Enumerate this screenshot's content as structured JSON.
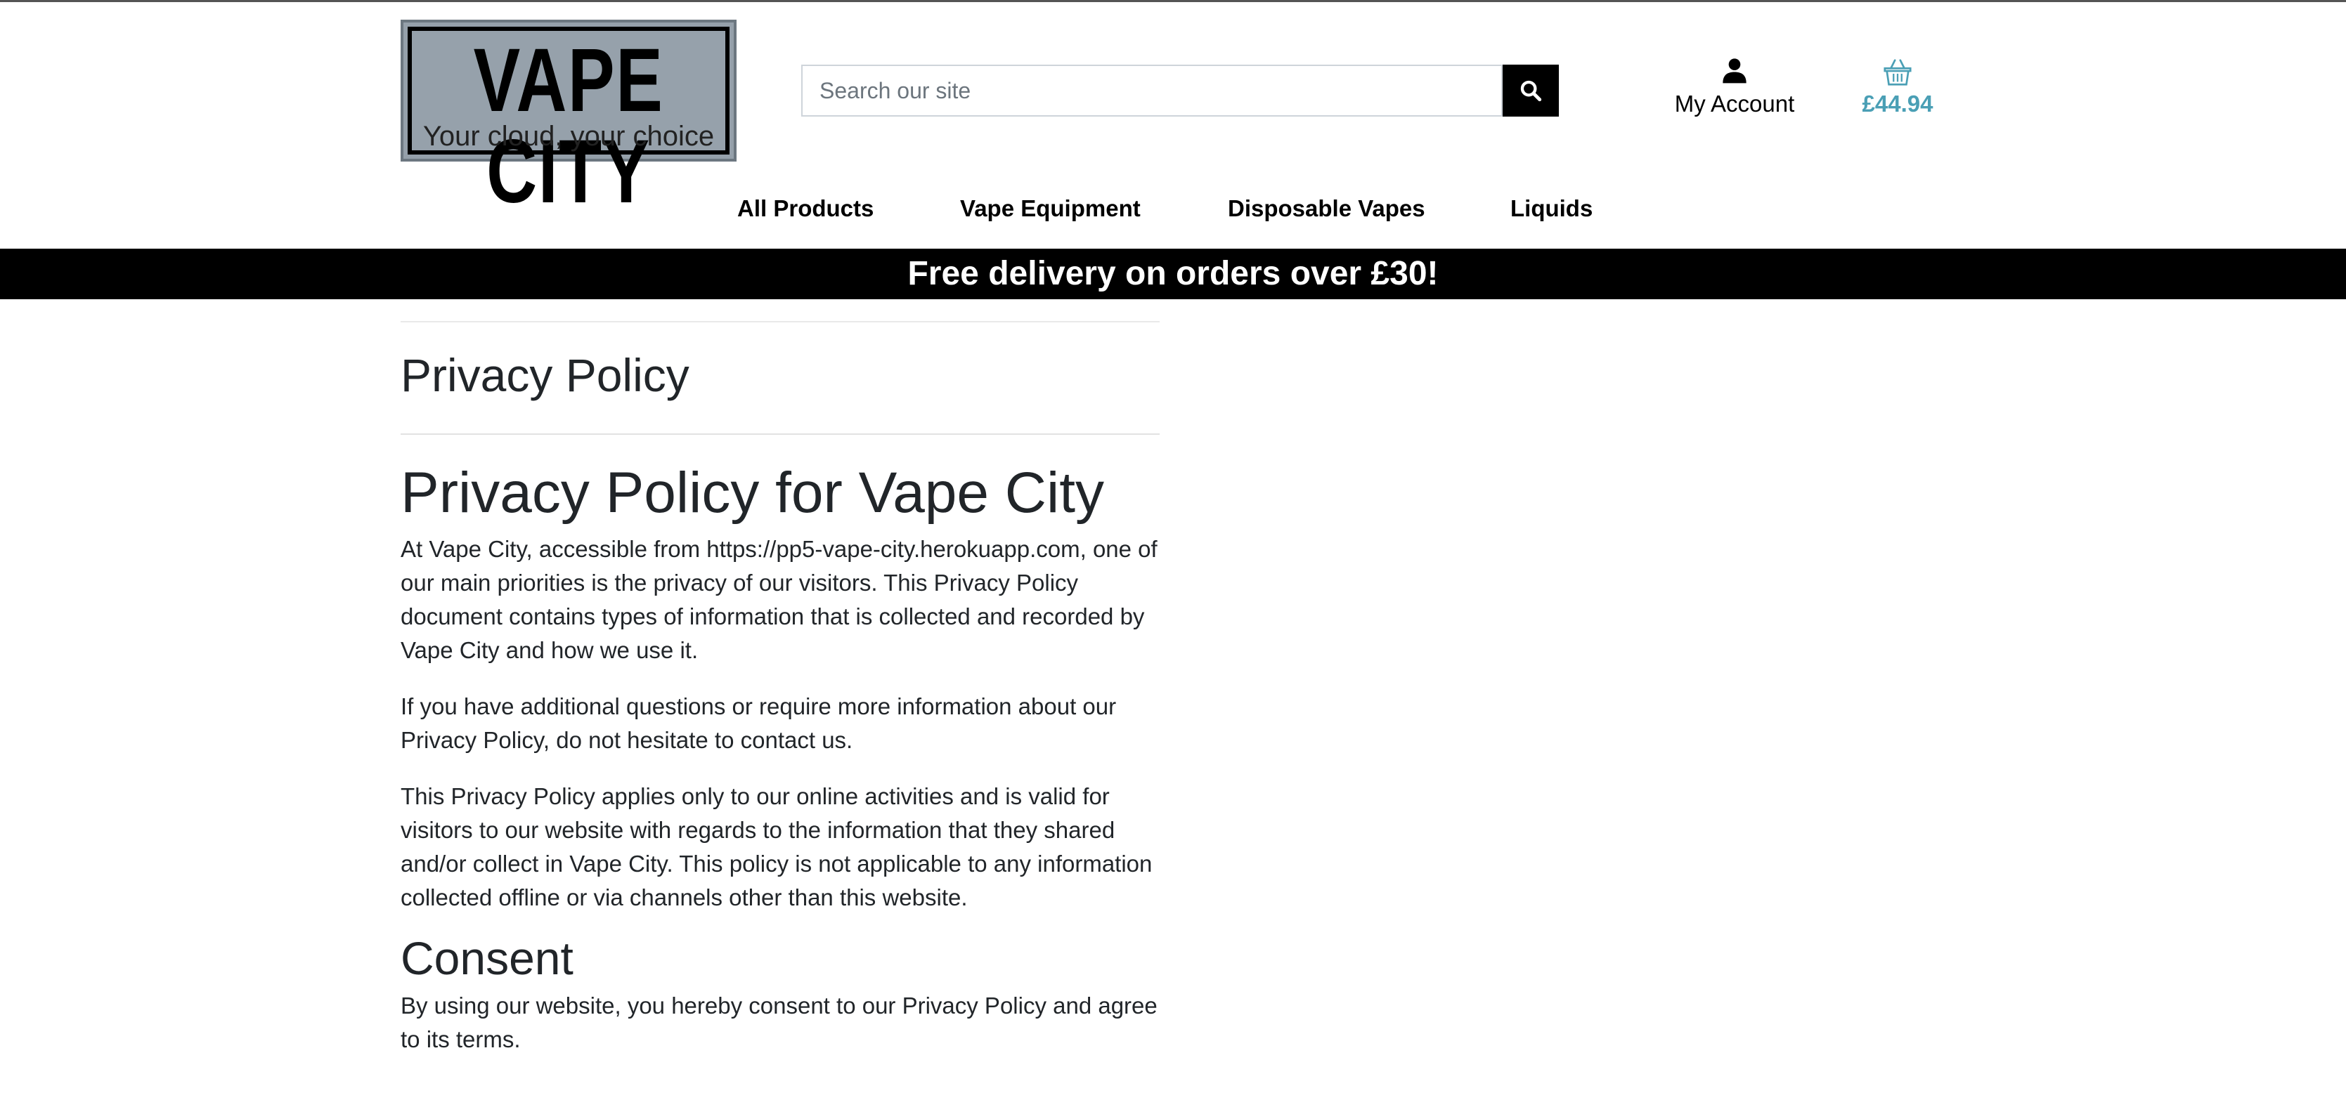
{
  "header": {
    "logo": {
      "title": "VAPE CITY",
      "tagline": "Your cloud, your choice"
    },
    "search": {
      "placeholder": "Search our site",
      "value": "",
      "button_icon": "search-icon"
    },
    "account": {
      "label": "My Account",
      "icon": "user-icon"
    },
    "basket": {
      "total": "£44.94",
      "icon": "basket-icon",
      "color": "#4a9fb5"
    }
  },
  "nav": {
    "items": [
      {
        "label": "All Products"
      },
      {
        "label": "Vape Equipment"
      },
      {
        "label": "Disposable Vapes"
      },
      {
        "label": "Liquids"
      }
    ]
  },
  "banner": {
    "text": "Free delivery on orders over £30!"
  },
  "page": {
    "title": "Privacy Policy",
    "heading": "Privacy Policy for Vape City",
    "paragraphs": [
      "At Vape City, accessible from https://pp5-vape-city.herokuapp.com, one of our main priorities is the privacy of our visitors. This Privacy Policy document contains types of information that is collected and recorded by Vape City and how we use it.",
      "If you have additional questions or require more information about our Privacy Policy, do not hesitate to contact us.",
      "This Privacy Policy applies only to our online activities and is valid for visitors to our website with regards to the information that they shared and/or collect in Vape City. This policy is not applicable to any information collected offline or via channels other than this website."
    ],
    "consent_heading": "Consent",
    "consent_text": "By using our website, you hereby consent to our Privacy Policy and agree to its terms."
  }
}
